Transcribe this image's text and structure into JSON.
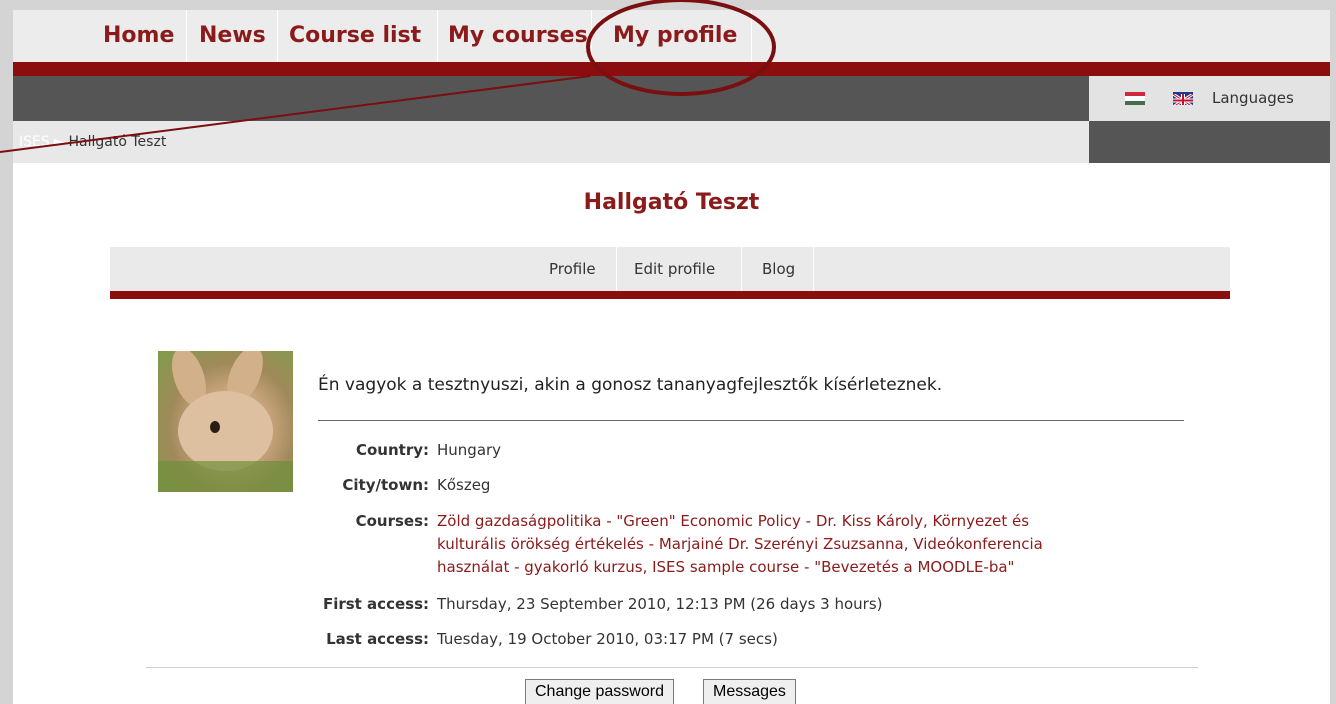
{
  "topnav": {
    "items": [
      "Home",
      "News",
      "Course list",
      "My courses",
      "My profile"
    ]
  },
  "languages": {
    "label": "Languages"
  },
  "breadcrumb": {
    "root": "ISES",
    "separator": "►",
    "current": "Hallgató Teszt"
  },
  "profile": {
    "title": "Hallgató Teszt",
    "tabs": [
      "Profile",
      "Edit profile",
      "Blog"
    ],
    "description": "Én vagyok a tesztnyuszi, akin a gonosz tananyagfejlesztők kísérleteznek.",
    "fields": [
      {
        "label": "Country:",
        "value": "Hungary"
      },
      {
        "label": "City/town:",
        "value": "Kőszeg"
      },
      {
        "label": "Courses:",
        "lines": [
          "Zöld gazdaságpolitika - \"Green\" Economic Policy - Dr. Kiss Károly, Környezet és",
          "kulturális örökség értékelés - Marjainé Dr. Szerényi Zsuzsanna, Videókonferencia",
          "használat - gyakorló kurzus, ISES sample course - \"Bevezetés a MOODLE-ba\""
        ]
      },
      {
        "label": "First access:",
        "value": "Thursday, 23 September 2010, 12:13 PM  (26 days 3 hours)"
      },
      {
        "label": "Last access:",
        "value": "Tuesday, 19 October 2010, 03:17 PM  (7 secs)"
      }
    ],
    "buttons": {
      "change_password": "Change password",
      "messages": "Messages"
    }
  },
  "colors": {
    "accent": "#8b0d0d",
    "link": "#8b1a1a",
    "dark_bar": "#555555"
  }
}
